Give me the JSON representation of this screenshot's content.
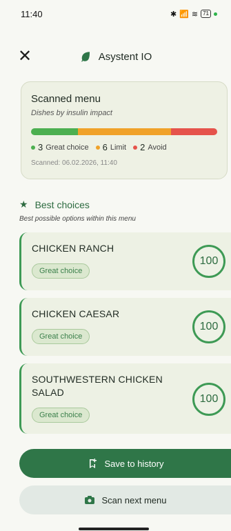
{
  "status": {
    "time": "11:40",
    "battery": "71"
  },
  "header": {
    "title": "Asystent IO"
  },
  "summary": {
    "title": "Scanned menu",
    "subtitle": "Dishes by insulin impact",
    "bar": {
      "great": 0.25,
      "limit": 0.5,
      "avoid": 0.25
    },
    "legend": [
      {
        "count": "3",
        "label": "Great choice",
        "color": "#4caf50"
      },
      {
        "count": "6",
        "label": "Limit",
        "color": "#f0a22a"
      },
      {
        "count": "2",
        "label": "Avoid",
        "color": "#e5534b"
      }
    ],
    "scanned": "Scanned: 06.02.2026, 11:40"
  },
  "section": {
    "title": "Best choices",
    "subtitle": "Best possible options within this menu"
  },
  "dishes": [
    {
      "name": "CHICKEN RANCH",
      "tag": "Great choice",
      "score": "100"
    },
    {
      "name": "CHICKEN CAESAR",
      "tag": "Great choice",
      "score": "100"
    },
    {
      "name": "SOUTHWESTERN CHICKEN SALAD",
      "tag": "Great choice",
      "score": "100"
    }
  ],
  "actions": {
    "save": "Save to history",
    "scan": "Scan next menu"
  }
}
